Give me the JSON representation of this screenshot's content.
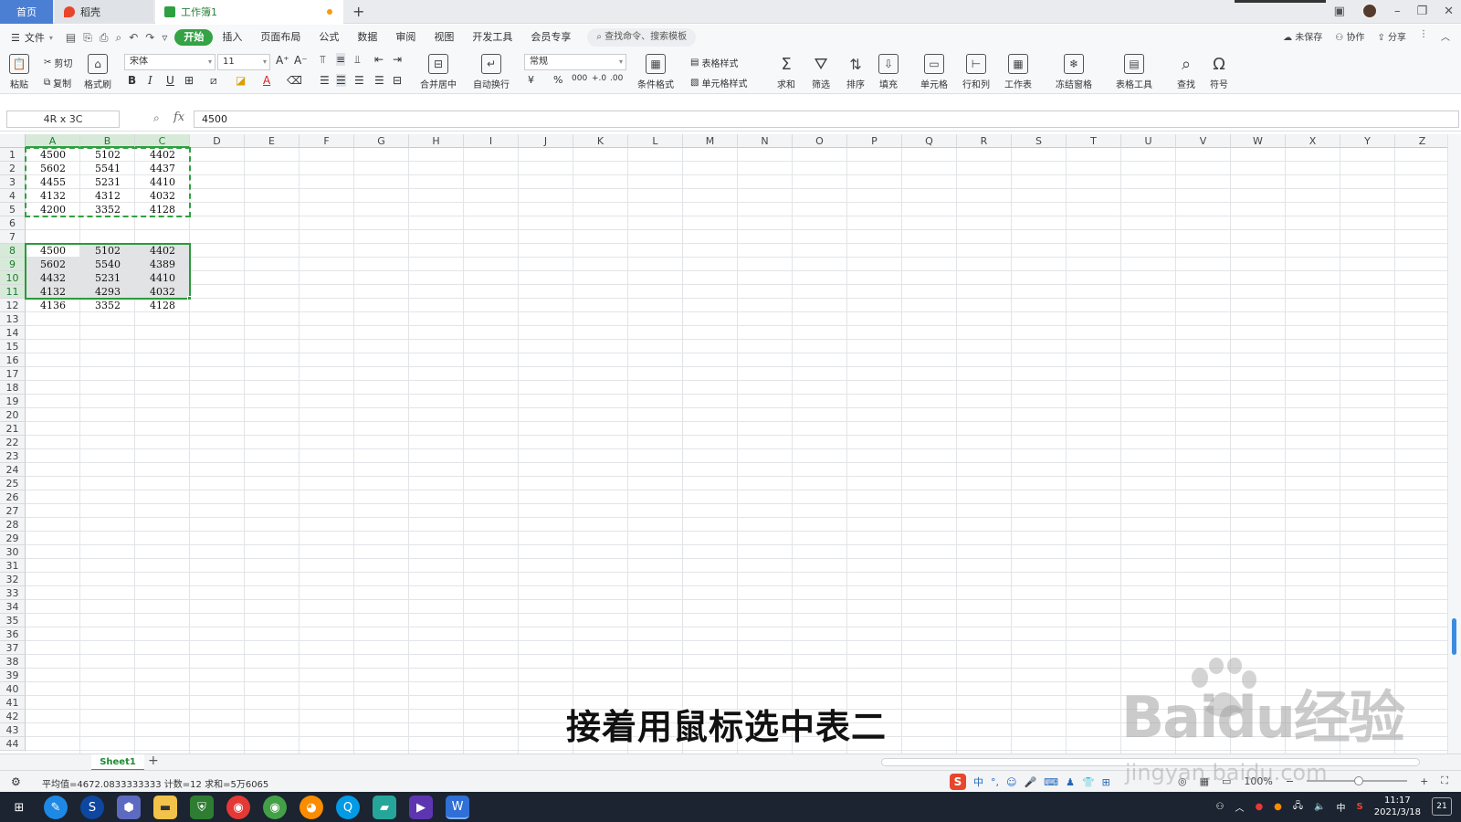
{
  "tabs": {
    "home": "首页",
    "daoke": "稻壳",
    "workbook": "工作簿1",
    "new_tab": "+"
  },
  "menu": {
    "file": "文件",
    "items": [
      "开始",
      "插入",
      "页面布局",
      "公式",
      "数据",
      "审阅",
      "视图",
      "开发工具",
      "会员专享"
    ],
    "search_placeholder": "查找命令、搜索模板",
    "unsaved": "未保存",
    "collab": "协作",
    "share": "分享"
  },
  "ribbon": {
    "paste": "粘贴",
    "cut": "剪切",
    "copy": "复制",
    "format_painter": "格式刷",
    "font_name": "宋体",
    "font_size": "11",
    "merge_center": "合并居中",
    "wrap_text": "自动换行",
    "number_format": "常规",
    "cond_format": "条件格式",
    "table_style": "表格样式",
    "cell_style": "单元格样式",
    "sum": "求和",
    "filter": "筛选",
    "sort": "排序",
    "fill": "填充",
    "cell": "单元格",
    "row_col": "行和列",
    "worksheet": "工作表",
    "freeze": "冻结窗格",
    "table_tools": "表格工具",
    "find": "查找",
    "symbol": "符号",
    "bold": "B",
    "italic": "I",
    "underline": "U",
    "font_color_glyph": "A",
    "currency": "¥",
    "percent": "%",
    "thousands": "000",
    "inc_decimal": "+.0",
    "dec_decimal": ".00"
  },
  "formula_bar": {
    "name_box": "4R x 3C",
    "fx": "fx",
    "value": "4500"
  },
  "columns": [
    "A",
    "B",
    "C",
    "D",
    "E",
    "F",
    "G",
    "H",
    "I",
    "J",
    "K",
    "L",
    "M",
    "N",
    "O",
    "P",
    "Q",
    "R",
    "S",
    "T",
    "U",
    "V",
    "W",
    "X",
    "Y",
    "Z"
  ],
  "rows": [
    "1",
    "2",
    "3",
    "4",
    "5",
    "6",
    "7",
    "8",
    "9",
    "10",
    "11",
    "12",
    "13",
    "14",
    "15",
    "16",
    "17",
    "18",
    "19",
    "20",
    "21",
    "22",
    "23",
    "24",
    "25",
    "26",
    "27",
    "28",
    "29",
    "30",
    "31",
    "32",
    "33",
    "34",
    "35",
    "36",
    "37",
    "38",
    "39",
    "40",
    "41",
    "42",
    "43",
    "44"
  ],
  "table1": [
    [
      "4500",
      "5102",
      "4402"
    ],
    [
      "5602",
      "5541",
      "4437"
    ],
    [
      "4455",
      "5231",
      "4410"
    ],
    [
      "4132",
      "4312",
      "4032"
    ],
    [
      "4200",
      "3352",
      "4128"
    ]
  ],
  "table2": [
    [
      "4500",
      "5102",
      "4402"
    ],
    [
      "5602",
      "5540",
      "4389"
    ],
    [
      "4432",
      "5231",
      "4410"
    ],
    [
      "4132",
      "4293",
      "4032"
    ],
    [
      "4136",
      "3352",
      "4128"
    ]
  ],
  "sheet": {
    "name": "Sheet1",
    "add": "+"
  },
  "status": {
    "summary": "平均值=4672.0833333333  计数=12  求和=5万6065",
    "ime_cn": "中",
    "zoom": "100%"
  },
  "subtitle": "接着用鼠标选中表二",
  "watermark": {
    "brand": "Baidu经验",
    "url": "jingyan.baidu.com"
  },
  "taskbar": {
    "time": "11:17",
    "date": "2021/3/18",
    "ime": "中",
    "notifications": "21"
  },
  "colors": {
    "accent_green": "#35a245",
    "selection_border": "#2a9a3a",
    "home_tab": "#4a7fd4",
    "taskbar": "#1b2430"
  }
}
